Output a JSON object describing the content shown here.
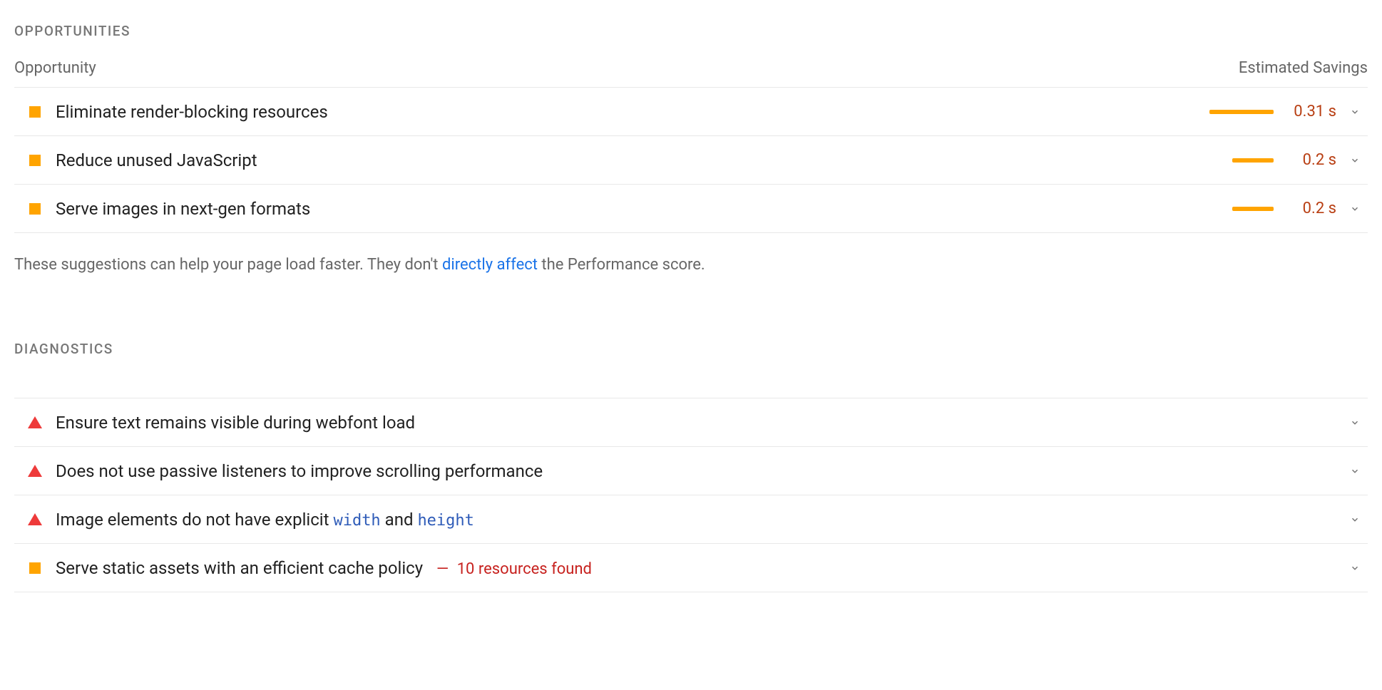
{
  "opportunities": {
    "title": "OPPORTUNITIES",
    "column_labels": {
      "opportunity": "Opportunity",
      "savings": "Estimated Savings"
    },
    "items": [
      {
        "label": "Eliminate render-blocking resources",
        "savings": "0.31 s",
        "bar_pct": 100
      },
      {
        "label": "Reduce unused JavaScript",
        "savings": "0.2 s",
        "bar_pct": 65
      },
      {
        "label": "Serve images in next-gen formats",
        "savings": "0.2 s",
        "bar_pct": 65
      }
    ],
    "footnote": {
      "pre": "These suggestions can help your page load faster. They don't ",
      "link": "directly affect",
      "post": " the Performance score."
    }
  },
  "diagnostics": {
    "title": "DIAGNOSTICS",
    "items": [
      {
        "severity": "fail",
        "label": "Ensure text remains visible during webfont load"
      },
      {
        "severity": "fail",
        "label": "Does not use passive listeners to improve scrolling performance"
      },
      {
        "severity": "fail",
        "label_pre": "Image elements do not have explicit ",
        "code1": "width",
        "mid": " and ",
        "code2": "height"
      },
      {
        "severity": "avg",
        "label": "Serve static assets with an efficient cache policy",
        "suffix_dash": "—",
        "suffix": "10 resources found"
      }
    ]
  }
}
